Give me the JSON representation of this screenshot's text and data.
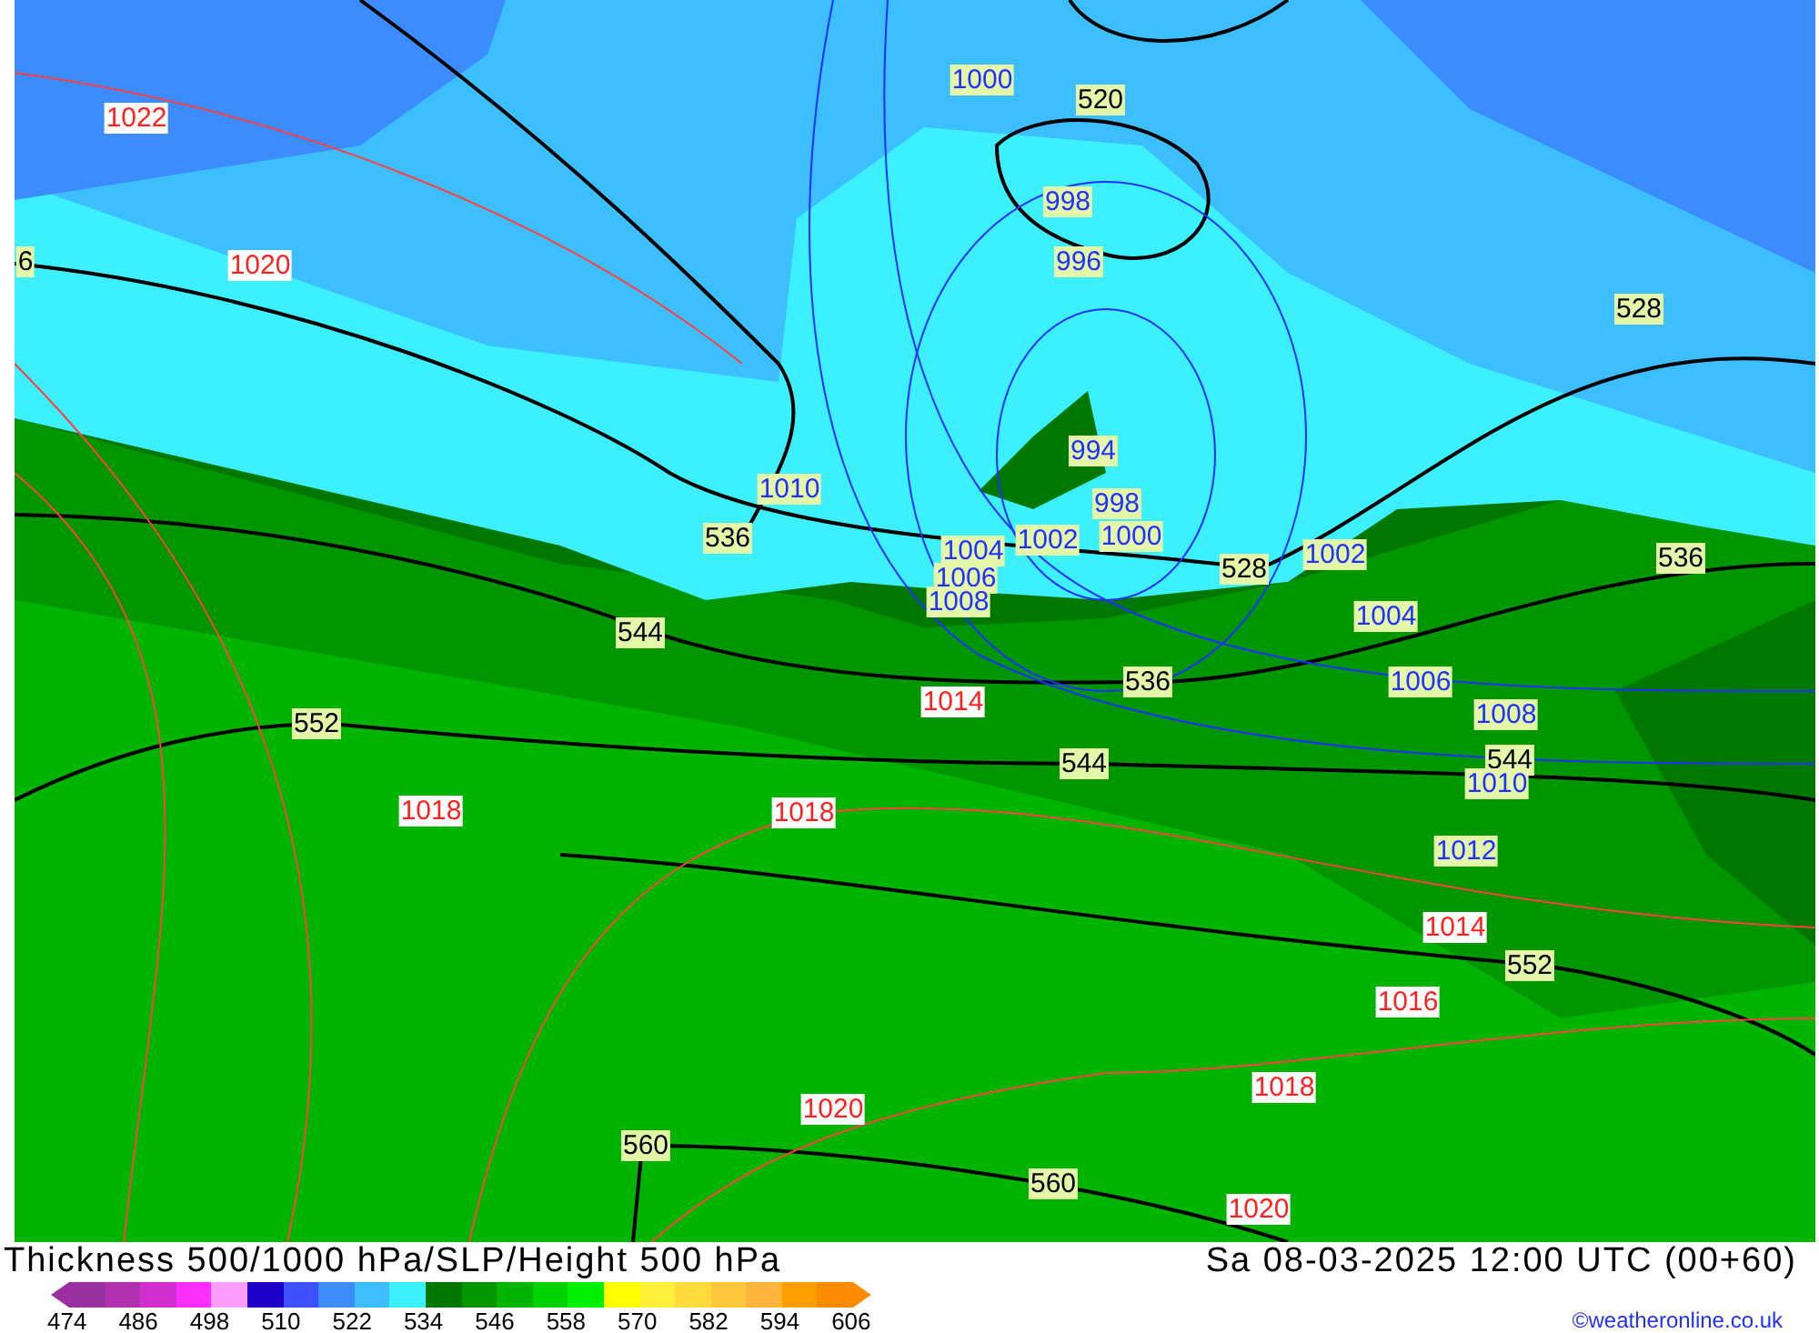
{
  "map": {
    "labels": [
      {
        "text": "1000",
        "kind": "low"
      },
      {
        "text": "520",
        "kind": "height"
      },
      {
        "text": "1022",
        "kind": "high"
      },
      {
        "text": "998",
        "kind": "low"
      },
      {
        "text": "6",
        "kind": "height"
      },
      {
        "text": "1020",
        "kind": "high"
      },
      {
        "text": "996",
        "kind": "low"
      },
      {
        "text": "528",
        "kind": "height"
      },
      {
        "text": "994",
        "kind": "low"
      },
      {
        "text": "1010",
        "kind": "low"
      },
      {
        "text": "998",
        "kind": "low"
      },
      {
        "text": "536",
        "kind": "height"
      },
      {
        "text": "1004",
        "kind": "low"
      },
      {
        "text": "1002",
        "kind": "low"
      },
      {
        "text": "1000",
        "kind": "low"
      },
      {
        "text": "528",
        "kind": "height"
      },
      {
        "text": "1002",
        "kind": "low"
      },
      {
        "text": "536",
        "kind": "height"
      },
      {
        "text": "1006",
        "kind": "low"
      },
      {
        "text": "1008",
        "kind": "low"
      },
      {
        "text": "1004",
        "kind": "low"
      },
      {
        "text": "544",
        "kind": "height"
      },
      {
        "text": "536",
        "kind": "height"
      },
      {
        "text": "1006",
        "kind": "low"
      },
      {
        "text": "1014",
        "kind": "high"
      },
      {
        "text": "1008",
        "kind": "low"
      },
      {
        "text": "552",
        "kind": "height"
      },
      {
        "text": "544",
        "kind": "height"
      },
      {
        "text": "544",
        "kind": "height"
      },
      {
        "text": "1010",
        "kind": "low"
      },
      {
        "text": "1018",
        "kind": "high"
      },
      {
        "text": "1018",
        "kind": "high"
      },
      {
        "text": "1012",
        "kind": "low"
      },
      {
        "text": "1014",
        "kind": "high"
      },
      {
        "text": "552",
        "kind": "height"
      },
      {
        "text": "1016",
        "kind": "high"
      },
      {
        "text": "1018",
        "kind": "high"
      },
      {
        "text": "1020",
        "kind": "high"
      },
      {
        "text": "560",
        "kind": "height"
      },
      {
        "text": "560",
        "kind": "height"
      },
      {
        "text": "1020",
        "kind": "high"
      }
    ]
  },
  "title": "Thickness 500/1000 hPa/SLP/Height 500 hPa",
  "datetime": "Sa 08-03-2025 12:00 UTC (00+60)",
  "legend": {
    "swatches": [
      {
        "color": "#9b30a0"
      },
      {
        "color": "#b030b0"
      },
      {
        "color": "#d030d0"
      },
      {
        "color": "#ff30ff"
      },
      {
        "color": "#ff9cff"
      },
      {
        "color": "#1e00c8"
      },
      {
        "color": "#3c50ff"
      },
      {
        "color": "#3c8cff"
      },
      {
        "color": "#3cbeff"
      },
      {
        "color": "#3cf0ff"
      },
      {
        "color": "#007800"
      },
      {
        "color": "#009600"
      },
      {
        "color": "#00b400"
      },
      {
        "color": "#00d200"
      },
      {
        "color": "#00f000"
      },
      {
        "color": "#ffff00"
      },
      {
        "color": "#fff03c"
      },
      {
        "color": "#ffdc3c"
      },
      {
        "color": "#ffc83c"
      },
      {
        "color": "#ffb43c"
      },
      {
        "color": "#ffa000"
      },
      {
        "color": "#ff8c00"
      }
    ],
    "ticks": [
      "474",
      "486",
      "498",
      "510",
      "522",
      "534",
      "546",
      "558",
      "570",
      "582",
      "594",
      "606"
    ]
  },
  "credit": "©weatheronline.co.uk"
}
